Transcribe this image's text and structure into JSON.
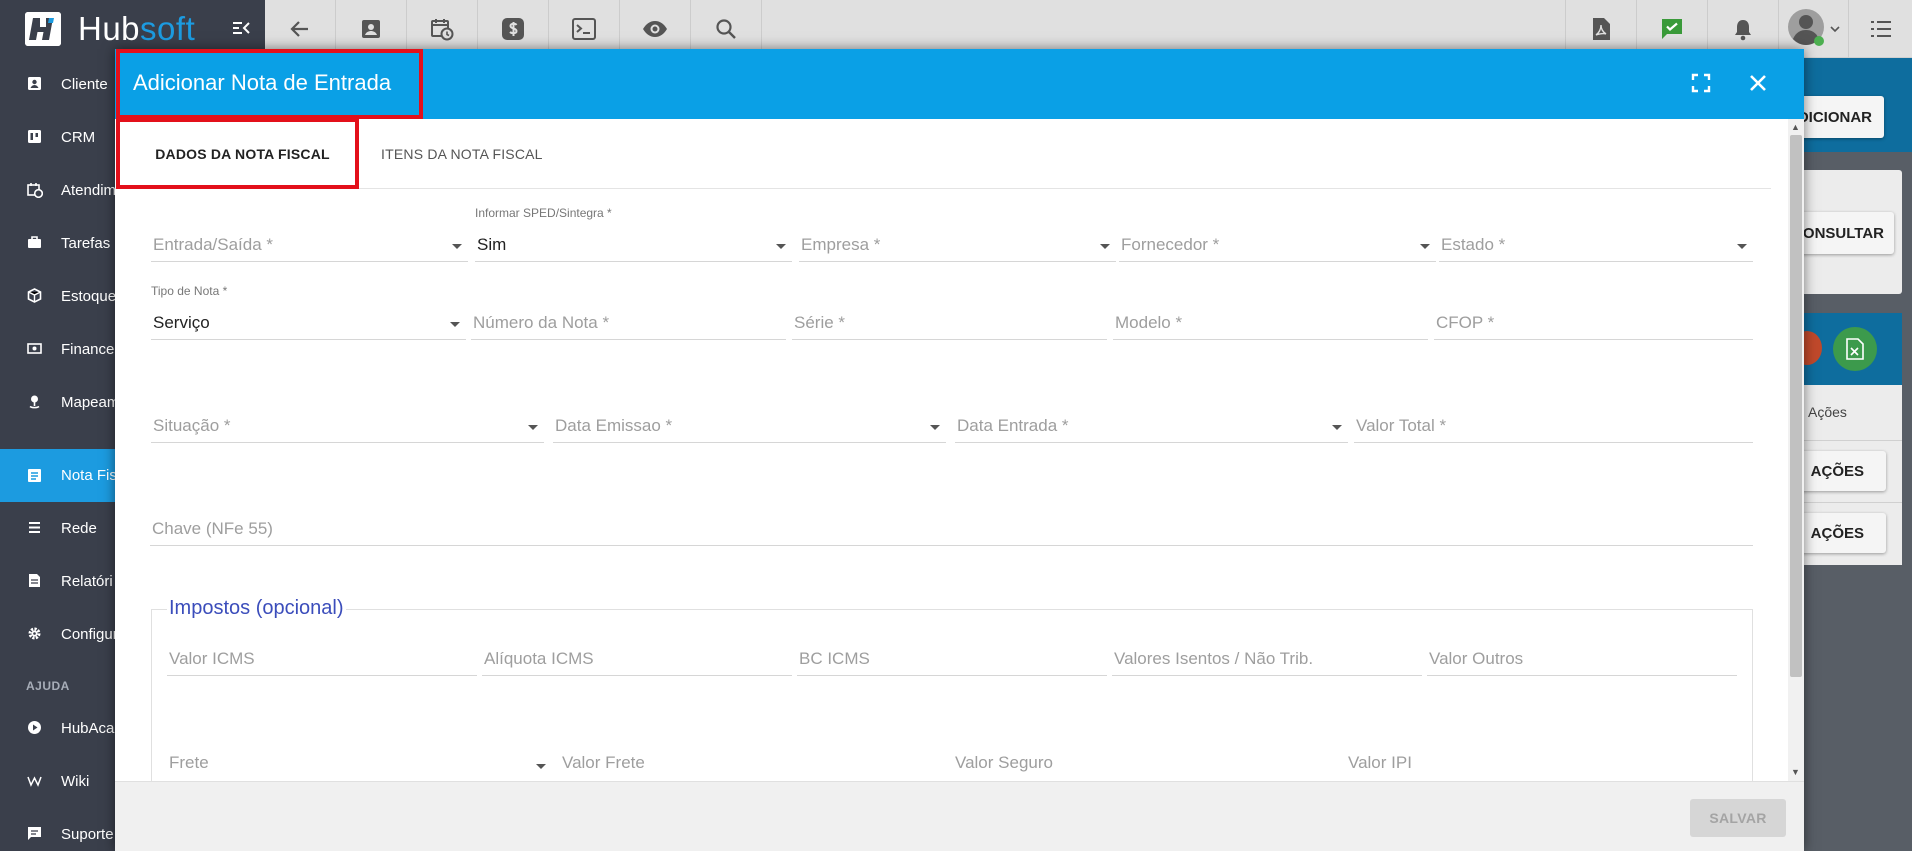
{
  "brand": {
    "name_part1": "Hub",
    "name_part2": "soft"
  },
  "colors": {
    "accent": "#0aa0e6",
    "sidebar_bg": "#3a3f4b",
    "highlight_red": "#e3101a",
    "section_title": "#3b4dbb"
  },
  "toolbar": {
    "icons": [
      "back-arrow-icon",
      "contact-card-icon",
      "calendar-clock-icon",
      "dollar-icon",
      "terminal-icon",
      "eye-icon",
      "search-icon"
    ],
    "right_icons": [
      "pdf-icon",
      "chat-check-icon",
      "bell-icon",
      "user-avatar",
      "menu-list-icon"
    ]
  },
  "sidebar": {
    "items": [
      {
        "label": "Cliente",
        "icon": "contact-icon"
      },
      {
        "label": "CRM",
        "icon": "kanban-icon"
      },
      {
        "label": "Atendim",
        "icon": "calendar-clock-icon"
      },
      {
        "label": "Tarefas",
        "icon": "briefcase-icon"
      },
      {
        "label": "Estoque",
        "icon": "box-icon"
      },
      {
        "label": "Financei",
        "icon": "money-icon"
      },
      {
        "label": "Mapeam",
        "icon": "map-pin-icon"
      },
      {
        "label": "Nota Fis",
        "icon": "document-icon"
      },
      {
        "label": "Rede",
        "icon": "network-icon"
      },
      {
        "label": "Relatóri",
        "icon": "report-icon"
      },
      {
        "label": "Configur",
        "icon": "gear-icon"
      }
    ],
    "section_label": "AJUDA",
    "help_items": [
      {
        "label": "HubAcad",
        "icon": "play-icon"
      },
      {
        "label": "Wiki",
        "icon": "wiki-icon"
      },
      {
        "label": "Suporte",
        "icon": "chat-icon"
      }
    ]
  },
  "background": {
    "adicionar_label": "DICIONAR",
    "consultar_label": "CONSULTAR",
    "acoes_header": "Ações",
    "acoes_btn1": "AÇÕES",
    "acoes_btn2": "AÇÕES"
  },
  "modal": {
    "title": "Adicionar Nota de Entrada",
    "tabs": [
      {
        "label": "DADOS DA NOTA FISCAL"
      },
      {
        "label": "ITENS DA NOTA FISCAL"
      }
    ],
    "fields": {
      "entrada_saida": {
        "placeholder": "Entrada/Saída *"
      },
      "sped": {
        "label": "Informar SPED/Sintegra *",
        "value": "Sim"
      },
      "empresa": {
        "placeholder": "Empresa *"
      },
      "fornecedor": {
        "placeholder": "Fornecedor *"
      },
      "estado": {
        "placeholder": "Estado *"
      },
      "tipo_nota": {
        "label": "Tipo de Nota *",
        "value": "Serviço"
      },
      "numero_nota": {
        "placeholder": "Número da Nota *"
      },
      "serie": {
        "placeholder": "Série *"
      },
      "modelo": {
        "placeholder": "Modelo *"
      },
      "cfop": {
        "placeholder": "CFOP *"
      },
      "situacao": {
        "placeholder": "Situação *"
      },
      "data_emissao": {
        "placeholder": "Data Emissao *"
      },
      "data_entrada": {
        "placeholder": "Data Entrada *"
      },
      "valor_total": {
        "placeholder": "Valor Total *"
      },
      "chave": {
        "placeholder": "Chave (NFe 55)"
      }
    },
    "impostos": {
      "title": "Impostos (opcional)",
      "fields": {
        "valor_icms": "Valor ICMS",
        "aliquota_icms": "Alíquota ICMS",
        "bc_icms": "BC ICMS",
        "valores_isentos": "Valores Isentos / Não Trib.",
        "valor_outros": "Valor Outros",
        "frete": "Frete",
        "valor_frete": "Valor Frete",
        "valor_seguro": "Valor Seguro",
        "valor_ipi": "Valor IPI"
      }
    },
    "save_label": "SALVAR"
  }
}
